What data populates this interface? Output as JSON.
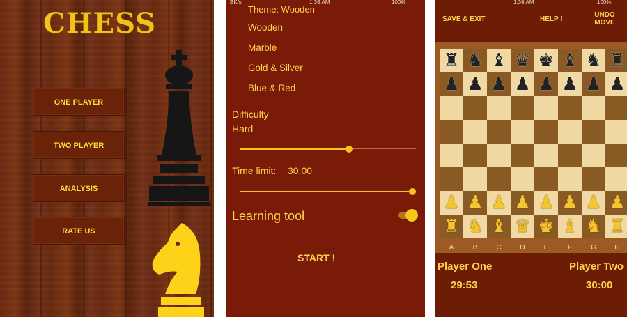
{
  "menu": {
    "title": "CHESS",
    "buttons": [
      "ONE PLAYER",
      "TWO PLAYER",
      "ANALYSIS",
      "RATE US"
    ]
  },
  "settings": {
    "status": {
      "left": "BK/s",
      "time": "1:36 AM",
      "battery": "100%"
    },
    "theme_header": "Theme: Wooden",
    "themes": [
      "Wooden",
      "Marble",
      "Gold & Silver",
      "Blue & Red"
    ],
    "difficulty_label": "Difficulty",
    "difficulty_value": "Hard",
    "difficulty_level": 0.62,
    "time_limit_label": "Time limit:",
    "time_limit_value": "30:00",
    "time_limit_level": 1.0,
    "learning_tool_label": "Learning tool",
    "learning_tool_on": true,
    "start_label": "START !"
  },
  "game": {
    "status": {
      "time": "1:36 AM",
      "battery": "100%"
    },
    "save_exit_label": "SAVE & EXIT",
    "help_label": "HELP !",
    "undo_label": "UNDO MOVE",
    "files": [
      "A",
      "B",
      "C",
      "D",
      "E",
      "F",
      "G",
      "H"
    ],
    "board": [
      [
        "r",
        "n",
        "b",
        "q",
        "k",
        "b",
        "n",
        "r"
      ],
      [
        "p",
        "p",
        "p",
        "p",
        "p",
        "p",
        "p",
        "p"
      ],
      [
        "",
        "",
        "",
        "",
        "",
        "",
        "",
        ""
      ],
      [
        "",
        "",
        "",
        "",
        "",
        "",
        "",
        ""
      ],
      [
        "",
        "",
        "",
        "",
        "",
        "",
        "",
        ""
      ],
      [
        "",
        "",
        "",
        "",
        "",
        "",
        "",
        ""
      ],
      [
        "P",
        "P",
        "P",
        "P",
        "P",
        "P",
        "P",
        "P"
      ],
      [
        "R",
        "N",
        "B",
        "Q",
        "K",
        "B",
        "N",
        "R"
      ]
    ],
    "player_one": "Player One",
    "player_two": "Player Two",
    "timer_one": "29:53",
    "timer_two": "30:00"
  },
  "colors": {
    "accent_yellow": "#ffd24a",
    "settings_bg": "#7a1a08",
    "game_bg": "#6d1c06",
    "board_light": "#f1d9a4",
    "board_dark": "#8a5a25"
  }
}
